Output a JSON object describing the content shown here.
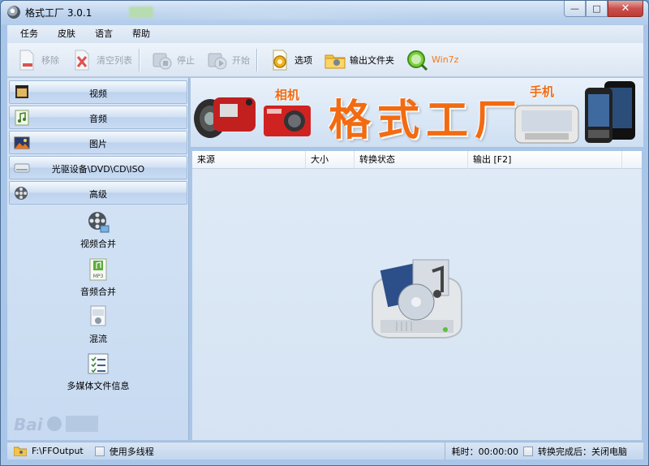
{
  "window": {
    "title": "格式工厂 3.0.1"
  },
  "menu": [
    "任务",
    "皮肤",
    "语言",
    "帮助"
  ],
  "toolbar": {
    "remove": "移除",
    "clear_list": "清空列表",
    "stop": "停止",
    "start": "开始",
    "options": "选项",
    "output_folder": "输出文件夹",
    "win7z": "Win7z"
  },
  "sidebar": {
    "categories": [
      {
        "label": "视频",
        "icon": "film-icon"
      },
      {
        "label": "音频",
        "icon": "music-note-icon"
      },
      {
        "label": "图片",
        "icon": "picture-icon"
      },
      {
        "label": "光驱设备\\DVD\\CD\\ISO",
        "icon": "disc-drive-icon"
      },
      {
        "label": "高级",
        "icon": "film-reel-icon"
      }
    ],
    "advanced_items": [
      {
        "label": "视频合并",
        "icon": "video-join-icon"
      },
      {
        "label": "音频合并",
        "icon": "audio-join-icon"
      },
      {
        "label": "混流",
        "icon": "mux-icon"
      },
      {
        "label": "多媒体文件信息",
        "icon": "media-info-icon"
      }
    ]
  },
  "banner": {
    "title": "格式工厂",
    "camera_label": "相机",
    "phone_label": "手机"
  },
  "table": {
    "columns": [
      "来源",
      "大小",
      "转换状态",
      "输出 [F2]"
    ]
  },
  "status": {
    "output_path": "F:\\FFOutput",
    "multithread": "使用多线程",
    "elapsed": "耗时：00:00:00",
    "after_convert": "转换完成后：关闭电脑"
  },
  "colors": {
    "accent_orange": "#f26b12",
    "win7z_orange": "#f27b1d",
    "panel_blue": "#c7daf1"
  }
}
